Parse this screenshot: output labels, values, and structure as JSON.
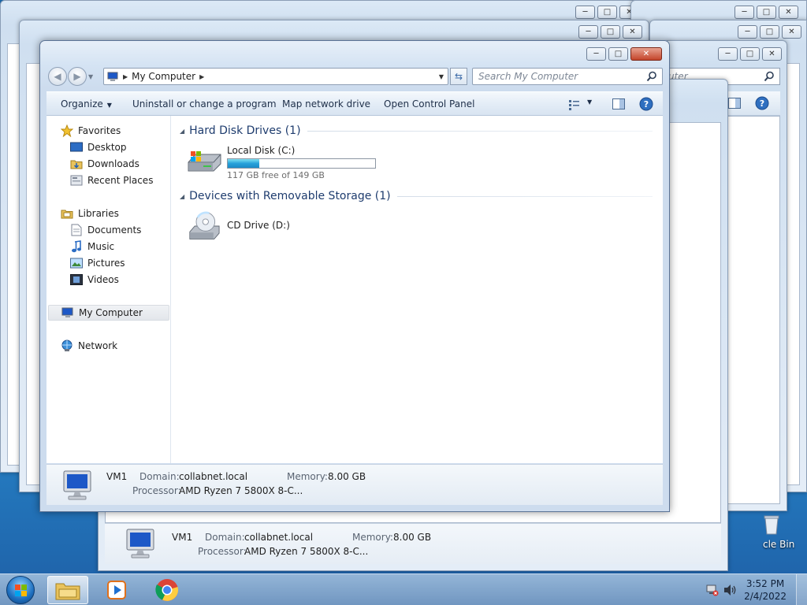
{
  "window": {
    "minimize_glyph": "─",
    "maximize_glyph": "□",
    "close_glyph": "✕"
  },
  "address": {
    "crumb": "My Computer",
    "search_placeholder": "Search My Computer",
    "partial_search_text": "uter"
  },
  "toolbar": {
    "organize": "Organize",
    "uninstall": "Uninstall or change a program",
    "map_drive": "Map network drive",
    "control_panel": "Open Control Panel"
  },
  "nav": {
    "favorites": "Favorites",
    "desktop": "Desktop",
    "downloads": "Downloads",
    "recent": "Recent Places",
    "libraries": "Libraries",
    "documents": "Documents",
    "music": "Music",
    "pictures": "Pictures",
    "videos": "Videos",
    "computer": "My Computer",
    "network": "Network"
  },
  "groups": {
    "hdd": "Hard Disk Drives (1)",
    "removable": "Devices with Removable Storage (1)"
  },
  "drives": {
    "c_name": "Local Disk (C:)",
    "c_free": "117 GB free of 149 GB",
    "c_used_fraction": 0.215,
    "d_name": "CD Drive (D:)"
  },
  "details": {
    "name": "VM1",
    "domain_label": "Domain:",
    "domain": "collabnet.local",
    "memory_label": "Memory:",
    "memory": "8.00 GB",
    "processor_label": "Processor:",
    "processor": "AMD Ryzen 7 5800X 8-C..."
  },
  "desktop": {
    "recycle_bin_partial": "cle Bin"
  },
  "taskbar": {
    "time": "3:52 PM",
    "date": "2/4/2022"
  },
  "icons": [
    "back-icon",
    "forward-icon",
    "computer-icon",
    "refresh-icon",
    "search-icon",
    "views-icon",
    "preview-pane-icon",
    "help-icon",
    "star-icon",
    "folder-icon",
    "library-icon",
    "network-icon",
    "hard-disk-icon",
    "cd-drive-icon",
    "start-orb-icon",
    "explorer-icon",
    "media-player-icon",
    "chrome-icon",
    "network-tray-icon",
    "volume-icon"
  ],
  "colors": {
    "title_bar": "#d4e3f3",
    "usage_fill": "#26a0da",
    "group_heading": "#1e3c6e",
    "close_button": "#c3442a"
  }
}
